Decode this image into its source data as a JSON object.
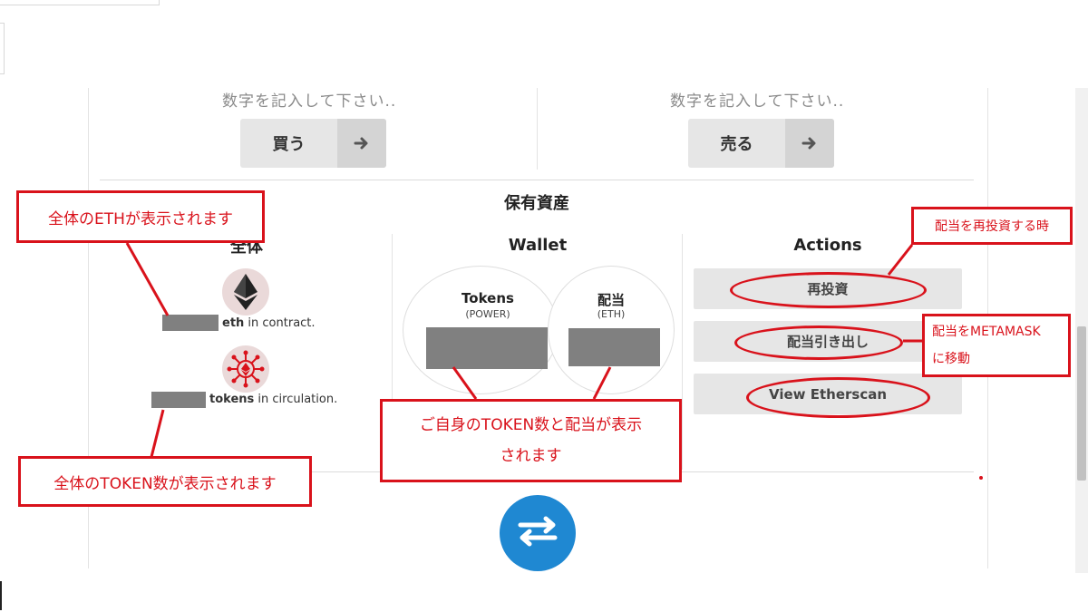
{
  "trade": {
    "buy": {
      "placeholder": "数字を記入して下さい..",
      "label": "買う"
    },
    "sell": {
      "placeholder": "数字を記入して下さい..",
      "label": "売る"
    }
  },
  "holdings": {
    "title": "保有資産",
    "overall": {
      "title": "全体",
      "eth_unit": "eth",
      "eth_suffix": " in contract.",
      "tokens_unit": "tokens",
      "tokens_suffix": " in circulation."
    },
    "wallet": {
      "title": "Wallet",
      "tokens": {
        "title": "Tokens",
        "sub": "(POWER)"
      },
      "dividend": {
        "title": "配当",
        "sub": "(ETH)"
      }
    },
    "actions": {
      "title": "Actions",
      "reinvest": "再投資",
      "withdraw": "配当引き出し",
      "etherscan": "View Etherscan"
    }
  },
  "annotations": {
    "eth_total": "全体のETHが表示されます",
    "token_total": "全体のTOKEN数が表示されます",
    "wallet_line1": "ご自身のTOKEN数と配当が表示",
    "wallet_line2": "されます",
    "reinvest": "配当を再投資する時",
    "metamask_line1": "配当をMETAMASK",
    "metamask_line2": "に移動"
  },
  "colors": {
    "annotation": "#d9121b",
    "swap_button": "#1f88d2",
    "button_bg": "#e6e6e6"
  },
  "icons": [
    "arrow-right-icon",
    "ethereum-icon",
    "token-network-icon",
    "swap-arrows-icon"
  ]
}
